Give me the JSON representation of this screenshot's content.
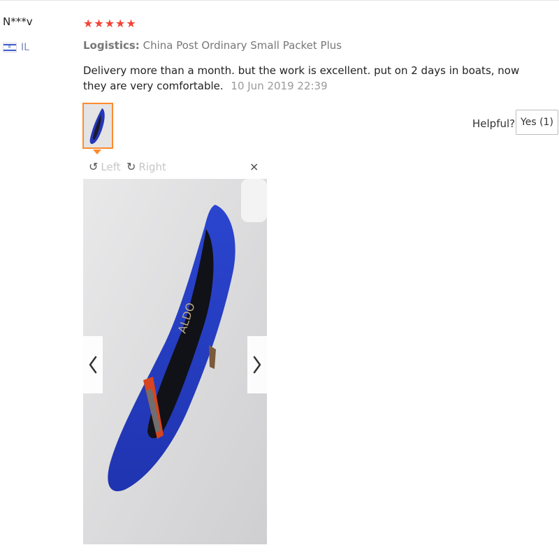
{
  "reviewer": {
    "name": "N***v",
    "country_code": "IL",
    "flag_icon": "israel-flag-icon"
  },
  "review": {
    "rating": "★★★★★",
    "logistics_label": "Logistics:",
    "logistics_value": "China Post Ordinary Small Packet Plus",
    "text": "Delivery more than a month. but the work is excellent. put on 2 days in boats, now they are very comfortable.",
    "date": "10 Jun 2019 22:39"
  },
  "helpful": {
    "label": "Helpful?",
    "yes_label": "Yes (1)"
  },
  "viewer": {
    "rotate_left_label": "Left",
    "rotate_right_label": "Right",
    "close_label": "×",
    "prev_icon": "chevron-left-icon",
    "next_icon": "chevron-right-icon"
  },
  "colors": {
    "star": "#f44336",
    "thumb_border": "#ff8a2d",
    "shoe": "#2437b8"
  }
}
